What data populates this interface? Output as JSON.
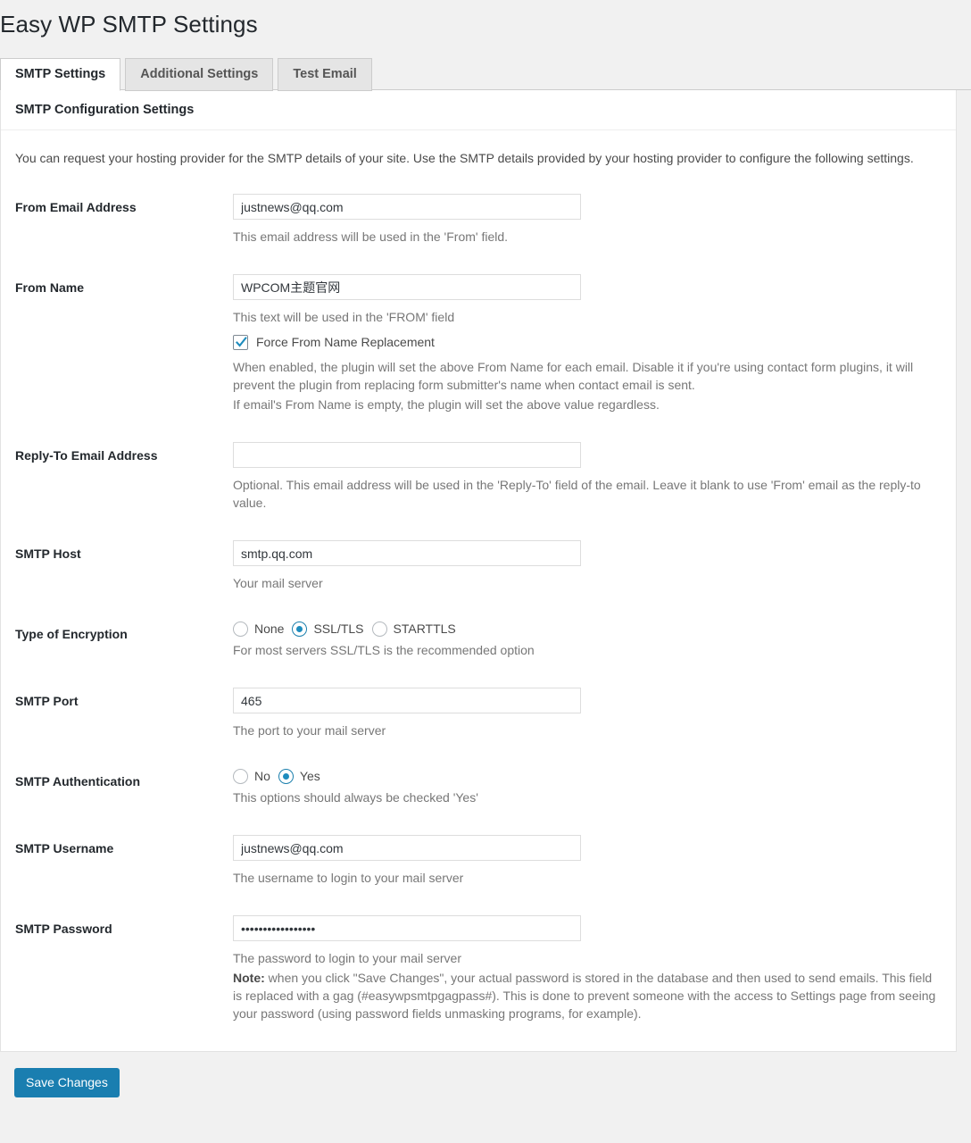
{
  "page": {
    "title": "Easy WP SMTP Settings"
  },
  "tabs": [
    {
      "label": "SMTP Settings",
      "active": true
    },
    {
      "label": "Additional Settings",
      "active": false
    },
    {
      "label": "Test Email",
      "active": false
    }
  ],
  "card": {
    "header": "SMTP Configuration Settings",
    "intro": "You can request your hosting provider for the SMTP details of your site. Use the SMTP details provided by your hosting provider to configure the following settings."
  },
  "fields": {
    "from_email": {
      "label": "From Email Address",
      "value": "justnews@qq.com",
      "placeholder": "",
      "hint": "This email address will be used in the 'From' field."
    },
    "from_name": {
      "label": "From Name",
      "value": "WPCOM主题官网",
      "placeholder": "",
      "hint": "This text will be used in the 'FROM' field",
      "checkbox_label": "Force From Name Replacement",
      "checkbox_checked": true,
      "hint2_line1": "When enabled, the plugin will set the above From Name for each email. Disable it if you're using contact form plugins, it will prevent the plugin from replacing form submitter's name when contact email is sent.",
      "hint2_line2": "If email's From Name is empty, the plugin will set the above value regardless."
    },
    "reply_to": {
      "label": "Reply-To Email Address",
      "value": "",
      "placeholder": "",
      "hint": "Optional. This email address will be used in the 'Reply-To' field of the email. Leave it blank to use 'From' email as the reply-to value."
    },
    "smtp_host": {
      "label": "SMTP Host",
      "value": "smtp.qq.com",
      "placeholder": "",
      "hint": "Your mail server"
    },
    "encryption": {
      "label": "Type of Encryption",
      "options": [
        {
          "label": "None",
          "checked": false
        },
        {
          "label": "SSL/TLS",
          "checked": true
        },
        {
          "label": "STARTTLS",
          "checked": false
        }
      ],
      "hint": "For most servers SSL/TLS is the recommended option"
    },
    "smtp_port": {
      "label": "SMTP Port",
      "value": "465",
      "placeholder": "",
      "hint": "The port to your mail server"
    },
    "smtp_auth": {
      "label": "SMTP Authentication",
      "options": [
        {
          "label": "No",
          "checked": false
        },
        {
          "label": "Yes",
          "checked": true
        }
      ],
      "hint": "This options should always be checked 'Yes'"
    },
    "smtp_username": {
      "label": "SMTP Username",
      "value": "justnews@qq.com",
      "placeholder": "",
      "hint": "The username to login to your mail server"
    },
    "smtp_password": {
      "label": "SMTP Password",
      "value": "•••••••••••••••••",
      "placeholder": "",
      "hint": "The password to login to your mail server",
      "note_prefix": "Note:",
      "note_body": " when you click \"Save Changes\", your actual password is stored in the database and then used to send emails. This field is replaced with a gag (#easywpsmtpgagpass#). This is done to prevent someone with the access to Settings page from seeing your password (using password fields unmasking programs, for example)."
    }
  },
  "actions": {
    "save_label": "Save Changes"
  },
  "colors": {
    "accent": "#1a7eb0",
    "radio_dot": "#1e8cbe",
    "check_mark": "#1e8cbe",
    "page_bg": "#f1f1f1",
    "card_bg": "#ffffff"
  }
}
